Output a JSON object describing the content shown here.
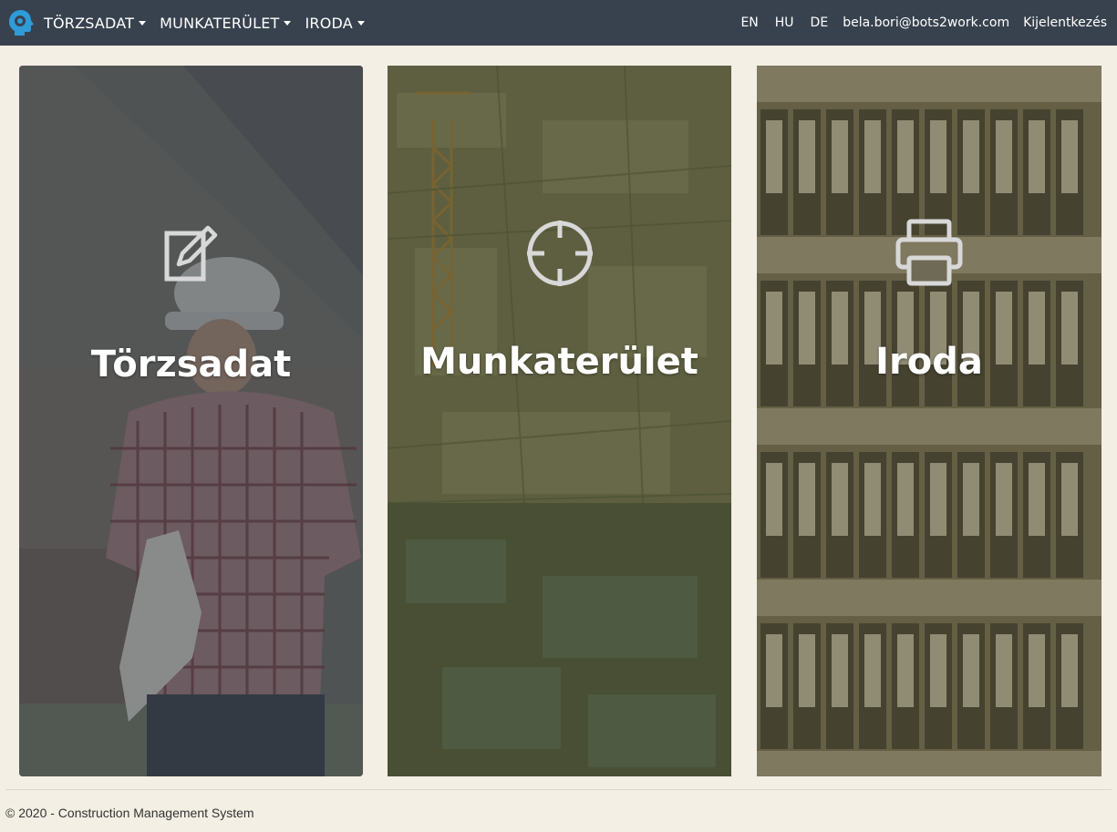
{
  "navbar": {
    "logo_icon": "head-logo-icon",
    "menus": [
      {
        "label": "TÖRZSADAT"
      },
      {
        "label": "MUNKATERÜLET"
      },
      {
        "label": "IRODA"
      }
    ],
    "languages": [
      "EN",
      "HU",
      "DE"
    ],
    "user_email": "bela.bori@bots2work.com",
    "logout_label": "Kijelentkezés"
  },
  "tiles": [
    {
      "title": "Törzsadat",
      "icon": "edit-icon"
    },
    {
      "title": "Munkaterület",
      "icon": "crosshair-icon"
    },
    {
      "title": "Iroda",
      "icon": "printer-icon"
    }
  ],
  "footer": {
    "text": "© 2020 - Construction Management System"
  },
  "colors": {
    "navbar": "#37424e",
    "background": "#f3efe4",
    "accent": "#2f9bd8"
  }
}
